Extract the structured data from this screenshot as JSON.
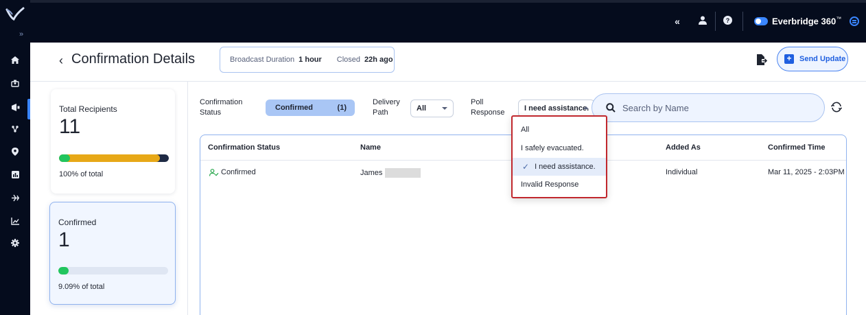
{
  "app": {
    "brand": "Everbridge 360",
    "trademark": "™"
  },
  "topbar": {
    "collapse_icon": "double-chevron-left-icon",
    "user_icon": "user-icon",
    "help_icon": "help-icon",
    "toggle_icon": "toggle-icon",
    "menu_icon": "chevron-circle-icon"
  },
  "nav": {
    "expand_label": "»",
    "items": [
      "home-icon",
      "contacts-icon",
      "notifications-icon",
      "incidents-icon",
      "location-icon",
      "reports-icon",
      "tasks-icon",
      "analytics-icon",
      "settings-icon"
    ],
    "active": "notifications-icon"
  },
  "header": {
    "back_glyph": "‹",
    "title": "Confirmation Details",
    "duration_label": "Broadcast Duration",
    "duration_value": "1 hour",
    "closed_label": "Closed",
    "closed_value": "22h ago",
    "send_label": "Send Update"
  },
  "cards": [
    {
      "label": "Total Recipients",
      "value": "11",
      "percent_text": "100% of total",
      "fill_fraction": 1.0,
      "colors": [
        "#22c55e",
        "#e7a817",
        "#1f2a44"
      ]
    },
    {
      "label": "Confirmed",
      "value": "1",
      "percent_text": "9.09% of total",
      "fill_fraction": 0.0909,
      "colors": [
        "#22c55e"
      ]
    }
  ],
  "filters": {
    "status_label_1": "Confirmation",
    "status_label_2": "Status",
    "status_value": "Confirmed",
    "status_count": "(1)",
    "path_label_1": "Delivery",
    "path_label_2": "Path",
    "path_value": "All",
    "poll_label_1": "Poll",
    "poll_label_2": "Response",
    "poll_value": "I need assistance.",
    "search_placeholder": "Search by Name"
  },
  "table": {
    "columns": [
      "Confirmation Status",
      "Name",
      "Added As",
      "Confirmed Time"
    ],
    "rows": [
      {
        "status": "Confirmed",
        "name": "James",
        "added_as": "Individual",
        "confirmed_time": "Mar 11, 2025 - 2:03PM"
      }
    ]
  },
  "dropdown": {
    "options": [
      "All",
      "I safely evacuated.",
      "I need assistance.",
      "Invalid Response"
    ],
    "selected_index": 2,
    "check_glyph": "✓"
  },
  "colors": {
    "accent": "#3a86ff",
    "nav_bg": "#050c1d",
    "highlight_border": "#c1272d"
  }
}
